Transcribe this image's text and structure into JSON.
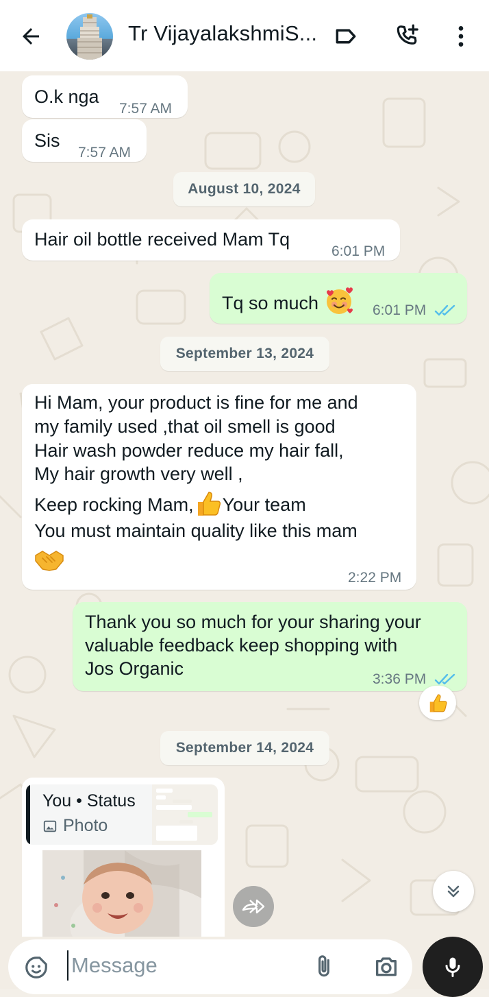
{
  "header": {
    "contact_name": "Tr VijayalakshmiS...",
    "icons": [
      "back-arrow-icon",
      "label-icon",
      "add-call-icon",
      "more-options-icon"
    ]
  },
  "messages": [
    {
      "dir": "in",
      "text": "O.k nga",
      "time": "7:57 AM"
    },
    {
      "dir": "in",
      "text": "Sis",
      "time": "7:57 AM"
    },
    {
      "dir": "date",
      "text": "August 10, 2024"
    },
    {
      "dir": "in",
      "text": "Hair oil bottle received Mam Tq",
      "time": "6:01 PM"
    },
    {
      "dir": "out",
      "text": "Tq so much",
      "emoji": "smiling-face-with-hearts",
      "time": "6:01 PM",
      "read": true
    },
    {
      "dir": "date",
      "text": "September 13, 2024"
    },
    {
      "dir": "in",
      "lines": [
        "Hi Mam, your product is fine for me and",
        "my family used ,that oil smell is good",
        "Hair wash powder reduce my hair fall,",
        "My hair growth very well ,",
        "Keep rocking Mam,",
        "Your team",
        "You must maintain quality like this mam"
      ],
      "time": "2:22 PM"
    },
    {
      "dir": "out",
      "lines": [
        "Thank you so much for your sharing your",
        "valuable feedback keep shopping with",
        "Jos Organic"
      ],
      "time": "3:36 PM",
      "read": true,
      "reaction": "thumbs-up"
    },
    {
      "dir": "date",
      "text": "September 14, 2024"
    }
  ],
  "status_reply": {
    "title": "You • Status",
    "subtitle": "Photo"
  },
  "composer": {
    "placeholder": "Message"
  },
  "colors": {
    "incoming_bubble": "#ffffff",
    "outgoing_bubble": "#d9fdd3",
    "read_ticks": "#53bdeb",
    "chat_background": "#f2ede5",
    "mic_button": "#1f1f1f"
  }
}
